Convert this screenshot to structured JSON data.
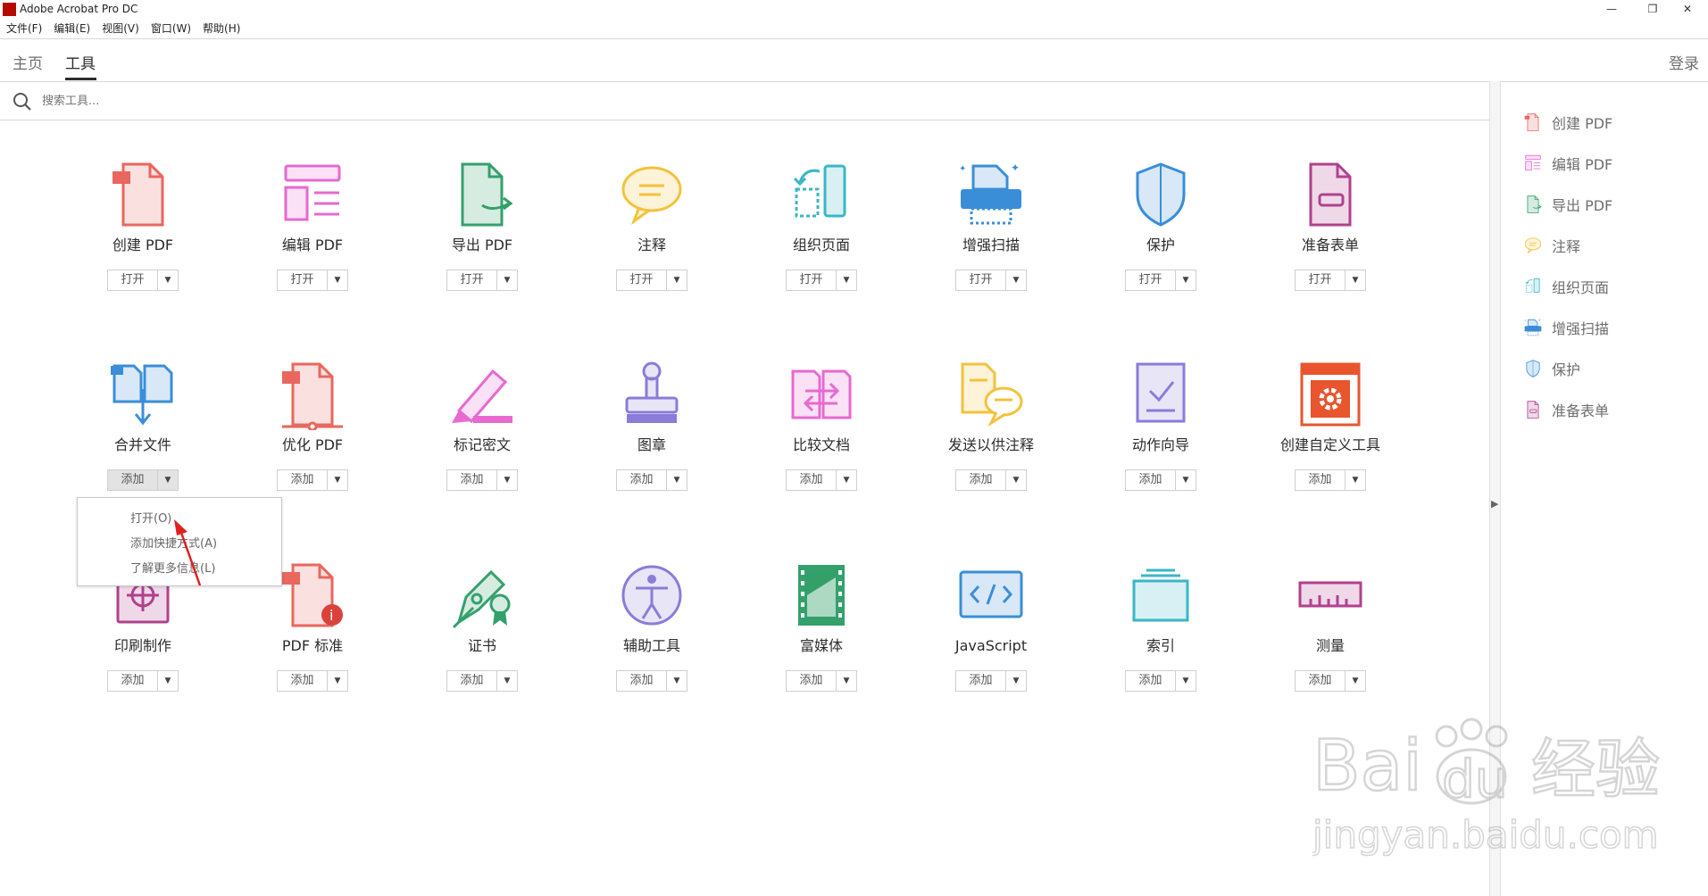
{
  "window": {
    "title": "Adobe Acrobat Pro DC",
    "controls": {
      "minimize": "—",
      "restore": "❐",
      "close": "✕"
    }
  },
  "menu": [
    "文件(F)",
    "编辑(E)",
    "视图(V)",
    "窗口(W)",
    "帮助(H)"
  ],
  "tabs": [
    {
      "label": "主页",
      "active": false
    },
    {
      "label": "工具",
      "active": true
    }
  ],
  "login_label": "登录",
  "search": {
    "placeholder": "搜索工具..."
  },
  "tools": [
    {
      "name": "创建 PDF",
      "button": "打开",
      "icon": "create-pdf-icon",
      "color": "#e8675e"
    },
    {
      "name": "编辑 PDF",
      "button": "打开",
      "icon": "edit-pdf-icon",
      "color": "#e66ad0"
    },
    {
      "name": "导出 PDF",
      "button": "打开",
      "icon": "export-pdf-icon",
      "color": "#34a06b"
    },
    {
      "name": "注释",
      "button": "打开",
      "icon": "comment-icon",
      "color": "#f3c23b"
    },
    {
      "name": "组织页面",
      "button": "打开",
      "icon": "organize-pages-icon",
      "color": "#3ab6c8"
    },
    {
      "name": "增强扫描",
      "button": "打开",
      "icon": "enhance-scan-icon",
      "color": "#3a8ed8"
    },
    {
      "name": "保护",
      "button": "打开",
      "icon": "protect-icon",
      "color": "#3a8ed8"
    },
    {
      "name": "准备表单",
      "button": "打开",
      "icon": "prepare-form-icon",
      "color": "#b0418e"
    },
    {
      "name": "合并文件",
      "button": "添加",
      "icon": "combine-files-icon",
      "color": "#3a8ed8"
    },
    {
      "name": "优化 PDF",
      "button": "添加",
      "icon": "optimize-pdf-icon",
      "color": "#e8675e"
    },
    {
      "name": "标记密文",
      "button": "添加",
      "icon": "redact-icon",
      "color": "#e66ad0"
    },
    {
      "name": "图章",
      "button": "添加",
      "icon": "stamp-icon",
      "color": "#8a7cd8"
    },
    {
      "name": "比较文档",
      "button": "添加",
      "icon": "compare-files-icon",
      "color": "#e66ad0"
    },
    {
      "name": "发送以供注释",
      "button": "添加",
      "icon": "send-for-comments-icon",
      "color": "#f3c23b"
    },
    {
      "name": "动作向导",
      "button": "添加",
      "icon": "action-wizard-icon",
      "color": "#8a7cd8"
    },
    {
      "name": "创建自定义工具",
      "button": "添加",
      "icon": "custom-tool-icon",
      "color": "#e8552e"
    },
    {
      "name": "印刷制作",
      "button": "添加",
      "icon": "print-production-icon",
      "color": "#b0418e"
    },
    {
      "name": "PDF 标准",
      "button": "添加",
      "icon": "pdf-standards-icon",
      "color": "#e8675e"
    },
    {
      "name": "证书",
      "button": "添加",
      "icon": "certificates-icon",
      "color": "#34a06b"
    },
    {
      "name": "辅助工具",
      "button": "添加",
      "icon": "accessibility-icon",
      "color": "#8a7cd8"
    },
    {
      "name": "富媒体",
      "button": "添加",
      "icon": "rich-media-icon",
      "color": "#34a06b"
    },
    {
      "name": "JavaScript",
      "button": "添加",
      "icon": "javascript-icon",
      "color": "#3a8ed8"
    },
    {
      "name": "索引",
      "button": "添加",
      "icon": "index-icon",
      "color": "#3ab6c8"
    },
    {
      "name": "测量",
      "button": "添加",
      "icon": "measure-icon",
      "color": "#b0418e"
    }
  ],
  "dropdown_menu": [
    "打开(O)",
    "添加快捷方式(A)",
    "了解更多信息(L)"
  ],
  "right_panel": [
    {
      "label": "创建 PDF",
      "icon": "create-pdf-icon"
    },
    {
      "label": "编辑 PDF",
      "icon": "edit-pdf-icon"
    },
    {
      "label": "导出 PDF",
      "icon": "export-pdf-icon"
    },
    {
      "label": "注释",
      "icon": "comment-icon"
    },
    {
      "label": "组织页面",
      "icon": "organize-pages-icon"
    },
    {
      "label": "增强扫描",
      "icon": "enhance-scan-icon"
    },
    {
      "label": "保护",
      "icon": "protect-icon"
    },
    {
      "label": "准备表单",
      "icon": "prepare-form-icon"
    }
  ],
  "watermark": {
    "text": "Bai du 经验",
    "url": "jingyan.baidu.com"
  }
}
